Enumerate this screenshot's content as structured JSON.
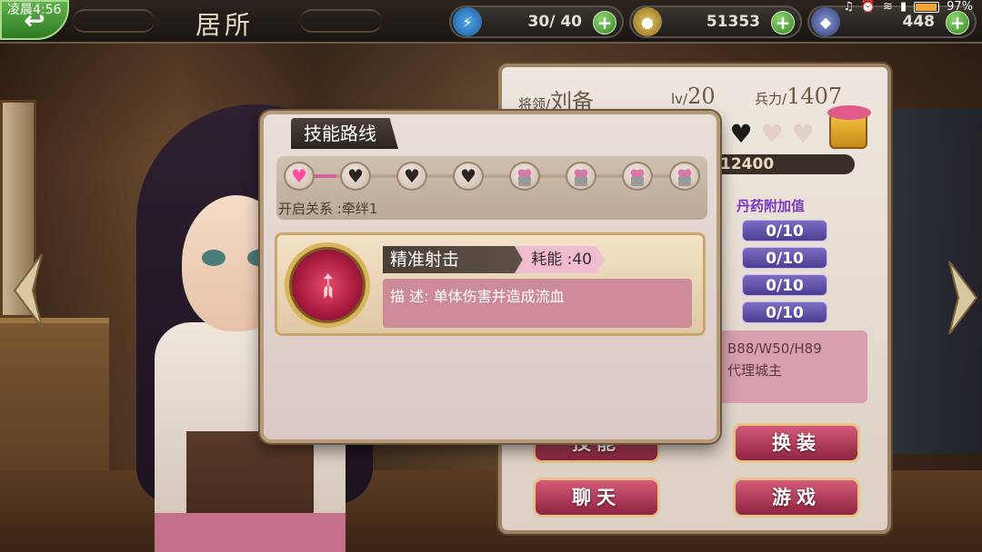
{
  "status": {
    "time": "凌晨4:56",
    "battery": "97%"
  },
  "topbar": {
    "title": "居所",
    "stamina": "30/ 40",
    "gold": "51353",
    "gems": "448"
  },
  "general": {
    "name_label": "将领/",
    "name": "刘备",
    "level_label": "lv/",
    "level": "20",
    "troops_label": "兵力/",
    "troops": "1407",
    "exp": "12400",
    "elixir_label": "丹药附加值",
    "elixir_values": [
      "0/10",
      "0/10",
      "0/10",
      "0/10"
    ],
    "measurements": "B88/W50/H89",
    "role": "代理城主"
  },
  "actions": {
    "skill": "技能",
    "change": "换装",
    "chat": "聊天",
    "game": "游戏"
  },
  "dialog": {
    "title": "技能路线",
    "relation": "开启关系 :牵绊1",
    "skill": {
      "name": "精准射击",
      "cost": "耗能 :40",
      "description": "描 述: 单体伤害并造成流血"
    },
    "nodes": [
      "active",
      "dark",
      "dark",
      "dark",
      "locked",
      "locked",
      "locked",
      "locked"
    ]
  },
  "colors": {
    "accent_pink": "#ff4fa3",
    "button_red": "#b63a5a",
    "pill_purple": "#5a4aa6"
  }
}
